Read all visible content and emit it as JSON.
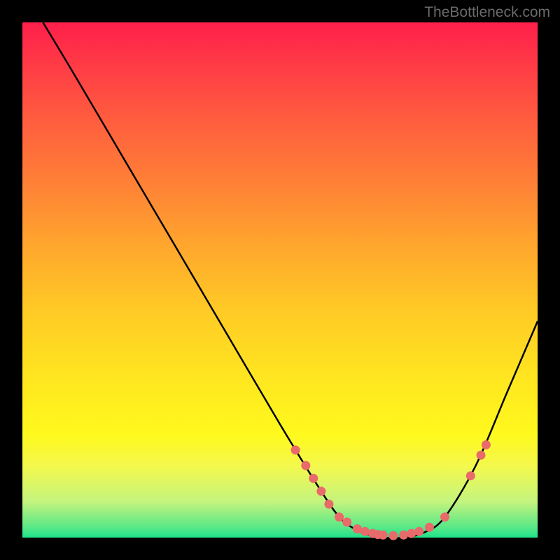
{
  "watermark": "TheBottleneck.com",
  "chart_data": {
    "type": "line",
    "title": "",
    "xlabel": "",
    "ylabel": "",
    "xlim": [
      0,
      100
    ],
    "ylim": [
      0,
      100
    ],
    "series": [
      {
        "name": "curve",
        "x": [
          4,
          10,
          20,
          30,
          40,
          50,
          58,
          62,
          66,
          70,
          74,
          78,
          82,
          88,
          94,
          100
        ],
        "y": [
          100,
          90,
          73,
          56,
          39,
          22,
          9,
          3.5,
          1,
          0,
          0,
          1,
          4,
          14,
          28,
          42
        ]
      }
    ],
    "markers": [
      {
        "x": 53,
        "y": 17
      },
      {
        "x": 55,
        "y": 14
      },
      {
        "x": 56.5,
        "y": 11.5
      },
      {
        "x": 58,
        "y": 9
      },
      {
        "x": 59.5,
        "y": 6.5
      },
      {
        "x": 61.5,
        "y": 4
      },
      {
        "x": 63,
        "y": 3
      },
      {
        "x": 65,
        "y": 1.7
      },
      {
        "x": 66.5,
        "y": 1.2
      },
      {
        "x": 68,
        "y": 0.8
      },
      {
        "x": 69,
        "y": 0.6
      },
      {
        "x": 70,
        "y": 0.5
      },
      {
        "x": 72,
        "y": 0.4
      },
      {
        "x": 74,
        "y": 0.5
      },
      {
        "x": 75.5,
        "y": 0.8
      },
      {
        "x": 77,
        "y": 1.2
      },
      {
        "x": 79,
        "y": 2
      },
      {
        "x": 82,
        "y": 4
      },
      {
        "x": 87,
        "y": 12
      },
      {
        "x": 89,
        "y": 16
      },
      {
        "x": 90,
        "y": 18
      }
    ],
    "marker_color": "#e86a6a",
    "curve_color": "#000000"
  }
}
